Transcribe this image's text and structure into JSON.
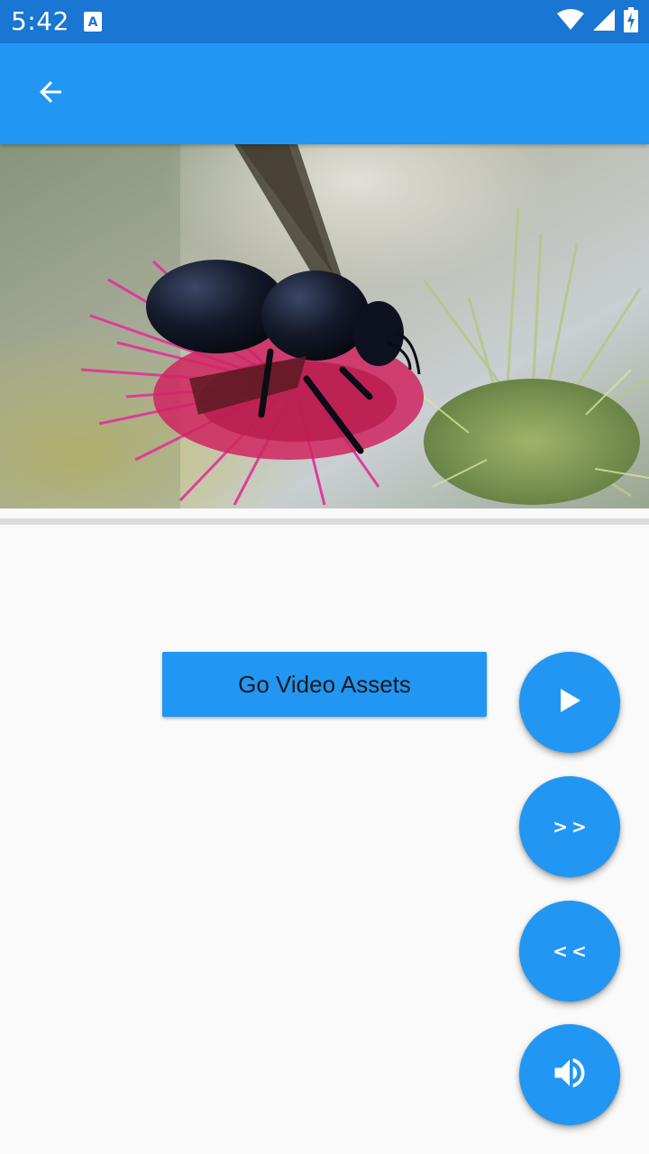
{
  "status_bar": {
    "time": "5:42",
    "notification_icon": "text-a-icon",
    "icons": [
      "wifi-icon",
      "cell-signal-icon",
      "battery-charging-icon"
    ],
    "background": "#1976d2"
  },
  "app_bar": {
    "back_icon": "arrow-back-icon",
    "background": "#2196f3"
  },
  "video": {
    "description_icon": "bee-on-thistle-frame",
    "progress": 0.0
  },
  "main": {
    "go_video_assets_label": "Go Video Assets"
  },
  "fabs": [
    {
      "icon": "play-icon",
      "label": ""
    },
    {
      "icon": "fast-forward-text",
      "label": ">>"
    },
    {
      "icon": "rewind-text",
      "label": "<<"
    },
    {
      "icon": "volume-up-icon",
      "label": ""
    }
  ],
  "colors": {
    "accent": "#2196f3",
    "background": "#fafafa"
  }
}
